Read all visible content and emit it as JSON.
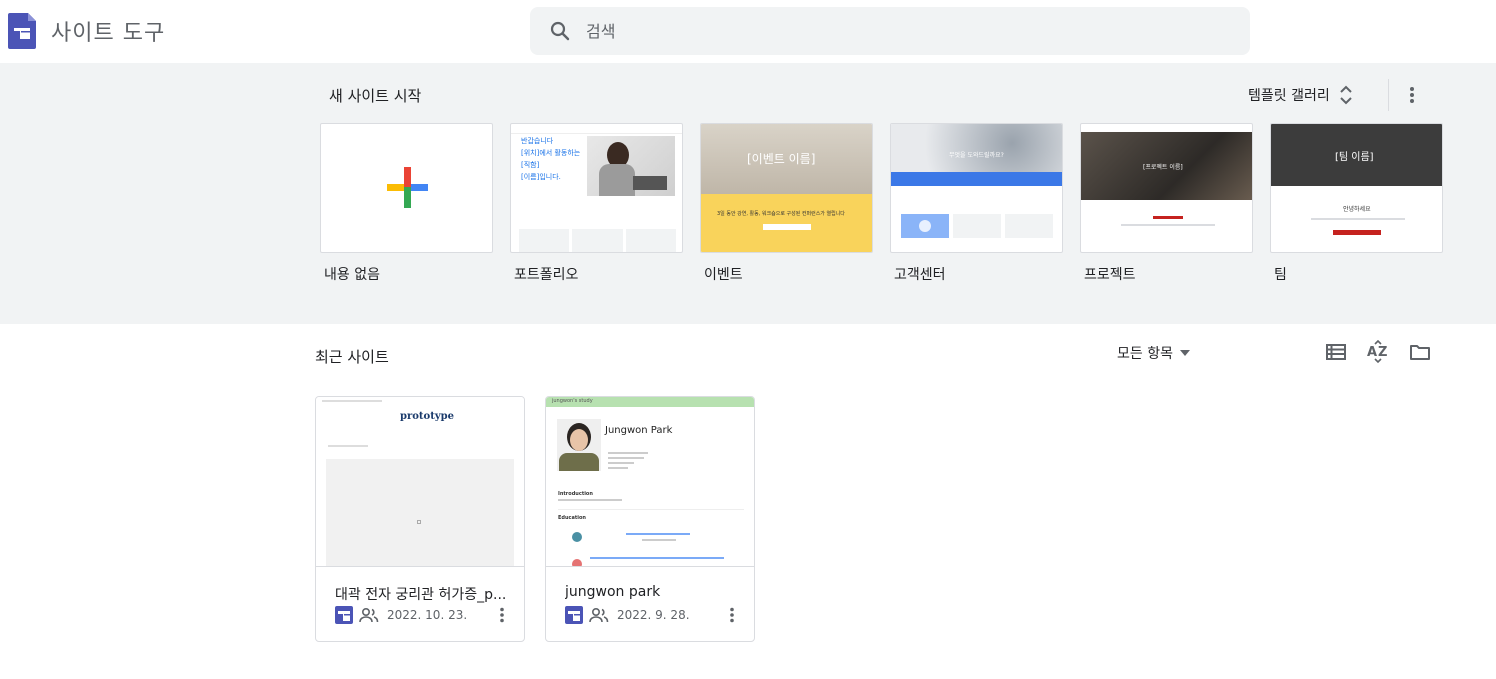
{
  "app": {
    "title": "사이트 도구",
    "brand_color": "#4b54b6"
  },
  "search": {
    "placeholder": "검색"
  },
  "templates": {
    "title": "새 사이트 시작",
    "gallery_label": "템플릿 갤러리",
    "items": [
      {
        "label": "내용 없음"
      },
      {
        "label": "포트폴리오",
        "thumb_lines": [
          "반갑습니다",
          "[위치]에서 활동하는",
          "[직함]",
          "[이름]입니다."
        ]
      },
      {
        "label": "이벤트",
        "thumb_title": "[이벤트 이름]",
        "thumb_band": "3일 동안 강연, 활동, 워크숍으로 구성된 컨퍼런스가 열립니다"
      },
      {
        "label": "고객센터",
        "thumb_title": "무엇을 도와드릴까요?"
      },
      {
        "label": "프로젝트",
        "thumb_title": "[프로젝트 이름]"
      },
      {
        "label": "팀",
        "thumb_title": "[팀 이름]",
        "thumb_sub": "안녕하세요"
      }
    ]
  },
  "recent": {
    "title": "최근 사이트",
    "filter_label": "모든 항목",
    "sites": [
      {
        "name": "대곽 전자 궁리관 허가증_p...",
        "date": "2022. 10. 23.",
        "thumb_title": "prototype"
      },
      {
        "name": "jungwon park",
        "date": "2022. 9. 28.",
        "thumb_title": "Jungwon Park",
        "thumb_header": "jungwon's study",
        "thumb_section1": "Introduction",
        "thumb_section2": "Education"
      }
    ]
  }
}
